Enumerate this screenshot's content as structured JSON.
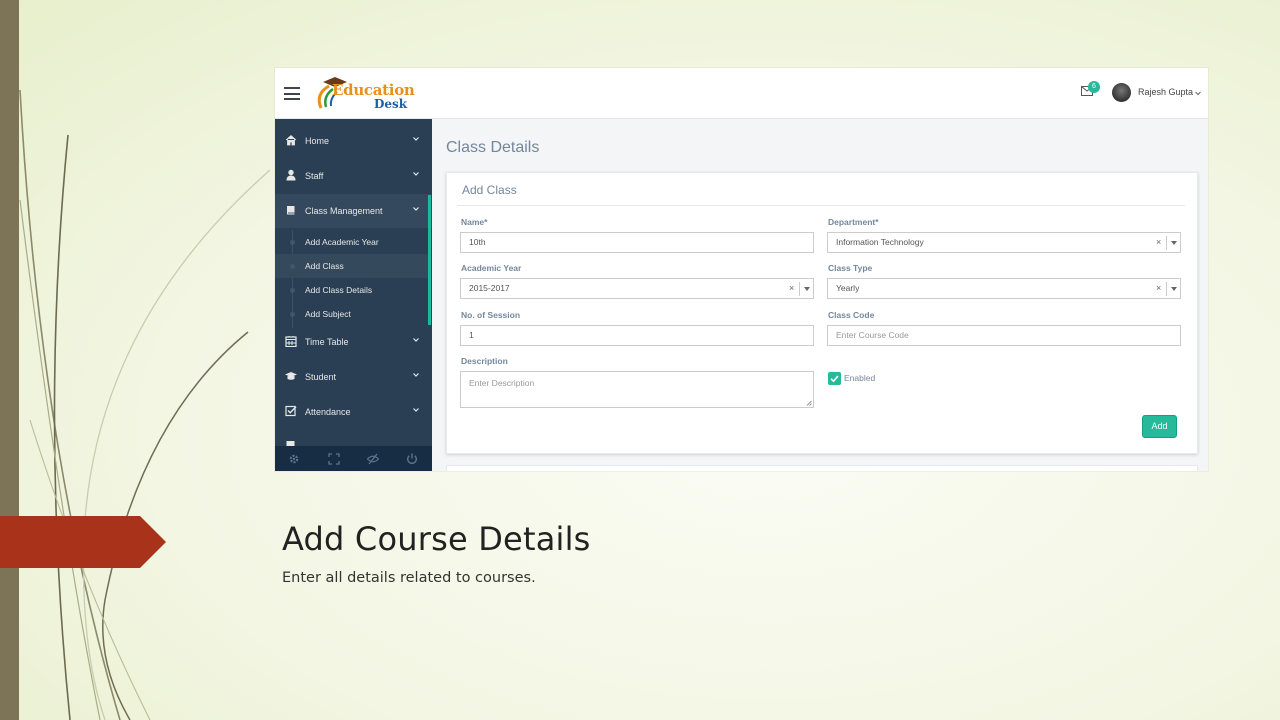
{
  "slide": {
    "title": "Add Course Details",
    "subtitle": "Enter all details related to courses."
  },
  "app": {
    "logo_line1": "Education",
    "logo_line2": "Desk",
    "notification_count": "6",
    "user_name": "Rajesh Gupta"
  },
  "sidebar": {
    "items": [
      {
        "label": "Home",
        "icon": "home-icon"
      },
      {
        "label": "Staff",
        "icon": "user-icon"
      },
      {
        "label": "Class Management",
        "icon": "book-icon"
      },
      {
        "label": "Time Table",
        "icon": "calendar-icon"
      },
      {
        "label": "Student",
        "icon": "graduation-cap-icon"
      },
      {
        "label": "Attendance",
        "icon": "checkbox-icon"
      }
    ],
    "subitems": [
      {
        "label": "Add Academic Year"
      },
      {
        "label": "Add Class"
      },
      {
        "label": "Add Class Details"
      },
      {
        "label": "Add Subject"
      }
    ],
    "footer_icons": [
      "settings-icon",
      "fullscreen-icon",
      "eye-slash-icon",
      "power-icon"
    ]
  },
  "main": {
    "page_title": "Class Details",
    "panel_title": "Add Class",
    "form": {
      "name_label": "Name*",
      "name_value": "10th",
      "department_label": "Department*",
      "department_value": "Information Technology",
      "academic_year_label": "Academic Year",
      "academic_year_value": "2015-2017",
      "class_type_label": "Class Type",
      "class_type_value": "Yearly",
      "sessions_label": "No. of Session",
      "sessions_value": "1",
      "class_code_label": "Class Code",
      "class_code_placeholder": "Enter Course Code",
      "description_label": "Description",
      "description_placeholder": "Enter Description",
      "enabled_label": "Enabled",
      "clear_symbol": "×",
      "add_button": "Add"
    }
  },
  "colors": {
    "sidebar_bg": "#2a3f54",
    "accent": "#26b99a",
    "slide_arrow": "#a8321a",
    "slide_bar": "#7d7458"
  }
}
